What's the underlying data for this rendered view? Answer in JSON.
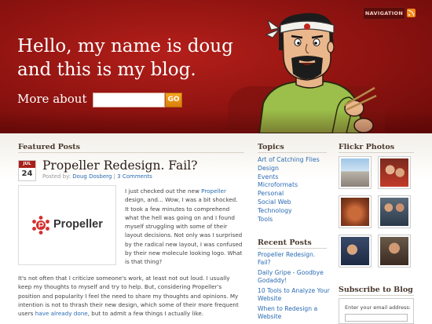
{
  "header": {
    "title": "Hello, my name is doug and this is my blog.",
    "more_about_label": "More about",
    "search_value": "",
    "go_label": "GO",
    "navigation_label": "NAVIGATION"
  },
  "featured": {
    "section_title": "Featured Posts",
    "post": {
      "date_month": "JUL",
      "date_day": "24",
      "title": "Propeller Redesign. Fail?",
      "meta_prefix": "Posted by:",
      "author": "Doug Dosberg",
      "separator": "|",
      "comments": "3 Comments",
      "image_logo_text": "Propeller",
      "text_right_1": "I just checked out the new ",
      "text_right_link": "Propeller",
      "text_right_2": " design, and... Wow, I was a bit shocked. It took a few minutes to comprehend what the hell was going on and I found myself struggling with some of their layout decisions. Not only was I surprised by the radical new layout, I was confused by their new molecule looking logo. What is that thing?",
      "text_full_1": "It's not often that I criticize someone's work, at least not out loud. I usually keep my thoughts to myself and try to help. But, considering Propeller's position and popularity I feel the need to share my thoughts and opinions. My intention is not to thrash their new design, which some of their more frequent users ",
      "text_full_link": "have already done",
      "text_full_2": ", but to admit a few things I actually like."
    }
  },
  "topics": {
    "section_title": "Topics",
    "items": [
      "Art of Catching Flies",
      "Design",
      "Events",
      "Microformats",
      "Personal",
      "Social Web",
      "Technology",
      "Tools"
    ]
  },
  "recent": {
    "section_title": "Recent Posts",
    "items": [
      "Propeller Redesign. Fail?",
      "Daily Gripe - Goodbye Godaddy!",
      "10 Tools to Analyze Your Website",
      "When to Redesign a Website"
    ]
  },
  "flickr": {
    "section_title": "Flickr Photos",
    "photos": [
      "photo-truck",
      "photo-people-red",
      "photo-crab-food",
      "photo-friends",
      "photo-group-selfie",
      "photo-man-smiling"
    ]
  },
  "subscribe": {
    "section_title": "Subscribe to Blog",
    "email_label": "Enter your email address:",
    "email_value": ""
  },
  "colors": {
    "header_red": "#8d1310",
    "link_blue": "#2a6bb3",
    "go_orange": "#f5a623",
    "heading_brown": "#4a3a2f"
  }
}
